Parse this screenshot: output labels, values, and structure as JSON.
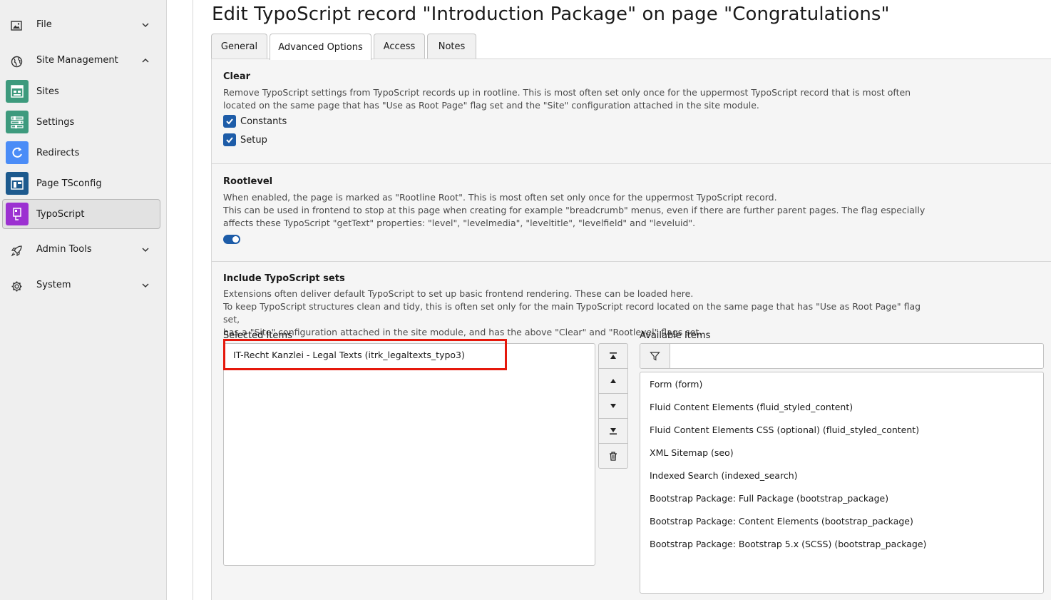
{
  "sidebar": {
    "groups": [
      {
        "label": "File",
        "icon": "image-icon",
        "expanded": false
      },
      {
        "label": "Site Management",
        "icon": "globe-icon",
        "expanded": true
      },
      {
        "label": "Admin Tools",
        "icon": "rocket-icon",
        "expanded": false
      },
      {
        "label": "System",
        "icon": "gear-icon",
        "expanded": false
      }
    ],
    "items": [
      {
        "label": "Sites",
        "icon": "sites-module-icon",
        "color": "#3d9a7d"
      },
      {
        "label": "Settings",
        "icon": "settings-module-icon",
        "color": "#3d9a7d"
      },
      {
        "label": "Redirects",
        "icon": "redirects-module-icon",
        "color": "#4a8cf7"
      },
      {
        "label": "Page TSconfig",
        "icon": "page-tsconfig-module-icon",
        "color": "#1d5a8e"
      },
      {
        "label": "TypoScript",
        "icon": "typoscript-module-icon",
        "color": "#9c31d1",
        "active": true
      }
    ]
  },
  "page": {
    "title": "Edit TypoScript record \"Introduction Package\" on page \"Congratulations\""
  },
  "tabs": [
    {
      "label": "General",
      "active": false
    },
    {
      "label": "Advanced Options",
      "active": true
    },
    {
      "label": "Access",
      "active": false
    },
    {
      "label": "Notes",
      "active": false
    }
  ],
  "clear": {
    "title": "Clear",
    "desc_line1": "Remove TypoScript settings from TypoScript records up in rootline. This is most often set only once for the uppermost TypoScript record that is most often",
    "desc_line2": "located on the same page that has \"Use as Root Page\" flag set and the \"Site\" configuration attached in the site module.",
    "constants_label": "Constants",
    "constants_checked": true,
    "setup_label": "Setup",
    "setup_checked": true
  },
  "rootlevel": {
    "title": "Rootlevel",
    "desc_line1": "When enabled, the page is marked as \"Rootline Root\". This is most often set only once for the uppermost TypoScript record.",
    "desc_line2": "This can be used in frontend to stop at this page when creating for example \"breadcrumb\" menus, even if there are further parent pages. The flag especially",
    "desc_line3": "affects these TypoScript \"getText\" properties: \"level\", \"levelmedia\", \"leveltitle\", \"levelfield\" and \"leveluid\".",
    "enabled": true
  },
  "include": {
    "title": "Include TypoScript sets",
    "desc_line1": "Extensions often deliver default TypoScript to set up basic frontend rendering. These can be loaded here.",
    "desc_line2": "To keep TypoScript structures clean and tidy, this is often set only for the main TypoScript record located on the same page that has \"Use as Root Page\" flag set,",
    "desc_line3": "has a \"Site\" configuration attached in the site module, and has the above \"Clear\" and \"Rootlevel\" flags set.",
    "selected_label": "Selected Items",
    "available_label": "Available Items",
    "filter_value": "",
    "selected_items": [
      "IT-Recht Kanzlei - Legal Texts (itrk_legaltexts_typo3)"
    ],
    "available_items": [
      "Form (form)",
      "Fluid Content Elements (fluid_styled_content)",
      "Fluid Content Elements CSS (optional) (fluid_styled_content)",
      "XML Sitemap (seo)",
      "Indexed Search (indexed_search)",
      "Bootstrap Package: Full Package (bootstrap_package)",
      "Bootstrap Package: Content Elements (bootstrap_package)",
      "Bootstrap Package: Bootstrap 5.x (SCSS) (bootstrap_package)"
    ],
    "buttons": [
      "move-to-top-icon",
      "move-up-icon",
      "move-down-icon",
      "move-to-bottom-icon",
      "trash-icon"
    ]
  },
  "colors": {
    "accent": "#1d5ca8",
    "highlight": "#e5180c"
  }
}
